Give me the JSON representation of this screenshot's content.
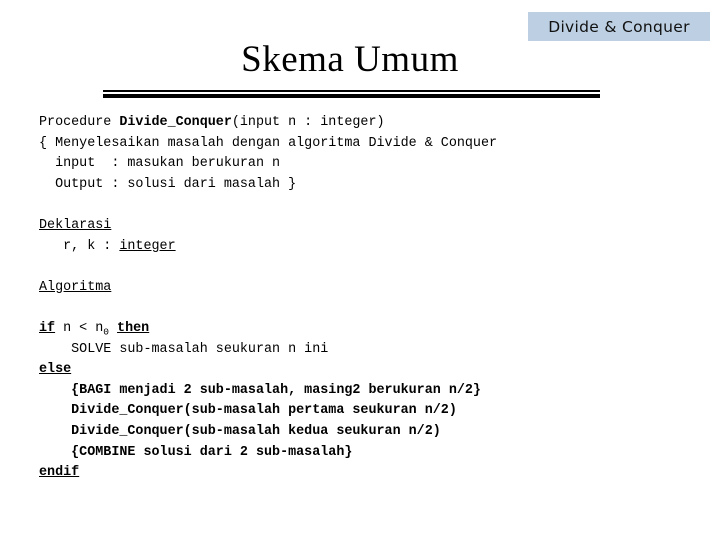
{
  "badge": {
    "label": "Divide & Conquer",
    "background": "#bdd0e3",
    "text_color": "#111111"
  },
  "title": {
    "text": "Skema Umum"
  },
  "divider": {
    "color": "#000000"
  },
  "pseudocode": {
    "font": "monospace",
    "lines": [
      {
        "id": "line-procedure",
        "segments": [
          {
            "text": "Procedure ",
            "style": "normal"
          },
          {
            "text": "Divide_Conquer",
            "style": "bold"
          },
          {
            "text": "(input n : integer)",
            "style": "normal"
          }
        ]
      },
      {
        "id": "line-comment-open",
        "segments": [
          {
            "text": "{ Menyelesaikan masalah dengan algoritma Divide & Conquer",
            "style": "normal"
          }
        ]
      },
      {
        "id": "line-input",
        "segments": [
          {
            "text": "  input  : masukan berukuran n",
            "style": "normal"
          }
        ]
      },
      {
        "id": "line-output",
        "segments": [
          {
            "text": "  Output : solusi dari masalah }",
            "style": "normal"
          }
        ]
      },
      {
        "id": "line-blank-1",
        "blank": true,
        "segments": []
      },
      {
        "id": "line-deklarasi",
        "segments": [
          {
            "text": "Deklarasi",
            "style": "underline"
          }
        ]
      },
      {
        "id": "line-vars",
        "segments": [
          {
            "text": "   r, k : ",
            "style": "normal"
          },
          {
            "text": "integer",
            "style": "underline"
          }
        ]
      },
      {
        "id": "line-blank-2",
        "blank": true,
        "segments": []
      },
      {
        "id": "line-algoritma",
        "segments": [
          {
            "text": "Algoritma",
            "style": "underline"
          }
        ]
      },
      {
        "id": "line-blank-3",
        "blank": true,
        "segments": []
      },
      {
        "id": "line-if",
        "segments": [
          {
            "text": "if",
            "style": "keyword"
          },
          {
            "text": " n < n",
            "style": "normal"
          },
          {
            "text": "0",
            "style": "subscript"
          },
          {
            "text": " ",
            "style": "normal"
          },
          {
            "text": "then",
            "style": "keyword"
          }
        ]
      },
      {
        "id": "line-solve",
        "segments": [
          {
            "text": "    SOLVE sub-masalah seukuran n ini",
            "style": "normal"
          }
        ]
      },
      {
        "id": "line-else",
        "segments": [
          {
            "text": "else",
            "style": "keyword"
          }
        ]
      },
      {
        "id": "line-bagi",
        "segments": [
          {
            "text": "    {BAGI menjadi 2 sub-masalah, masing2 berukuran n/2}",
            "style": "bold"
          }
        ]
      },
      {
        "id": "line-call-first",
        "segments": [
          {
            "text": "    Divide_Conquer(sub-masalah pertama seukuran n/2)",
            "style": "bold"
          }
        ]
      },
      {
        "id": "line-call-second",
        "segments": [
          {
            "text": "    Divide_Conquer(sub-masalah kedua seukuran n/2)",
            "style": "bold"
          }
        ]
      },
      {
        "id": "line-combine",
        "segments": [
          {
            "text": "    {COMBINE solusi dari 2 sub-masalah}",
            "style": "bold"
          }
        ]
      },
      {
        "id": "line-endif",
        "segments": [
          {
            "text": "endif",
            "style": "keyword"
          }
        ]
      }
    ]
  }
}
